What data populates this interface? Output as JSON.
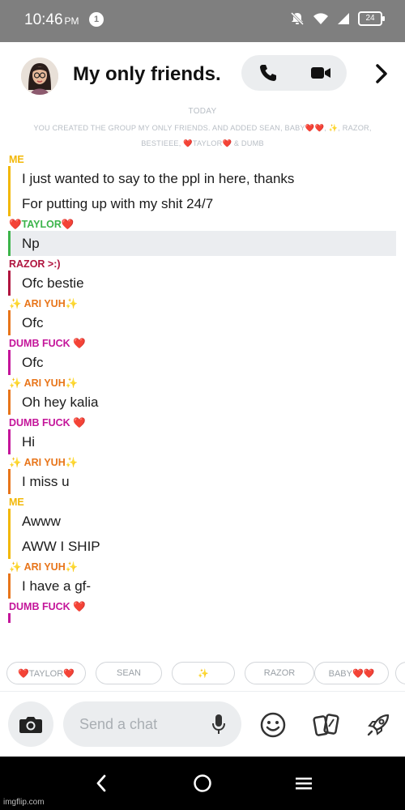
{
  "status_bar": {
    "time": "10:46",
    "ampm": "PM",
    "notification_count": "1",
    "battery": "24"
  },
  "header": {
    "title": "My only friends.",
    "call_icon": "phone-icon",
    "video_icon": "video-camera-icon",
    "more_icon": "chevron-right-icon"
  },
  "chat": {
    "date_label": "TODAY",
    "system_message": "YOU CREATED THE GROUP MY ONLY FRIENDS. AND ADDED SEAN, BABY❤️❤️, ✨, RAZOR, BESTIEEE, ❤️TAYLOR❤️ & DUMB",
    "groups": [
      {
        "sender": "ME",
        "color": "#f2b705",
        "messages": [
          "I just wanted to say to the ppl in here, thanks",
          "For putting up with my shit 24/7"
        ]
      },
      {
        "sender": "❤️TAYLOR❤️",
        "color": "#3cb44b",
        "messages": [
          "Np"
        ],
        "highlight": true
      },
      {
        "sender": "RAZOR >:)",
        "color": "#b0153f",
        "messages": [
          "Ofc bestie"
        ]
      },
      {
        "sender": "✨ ARI YUH✨",
        "color": "#e8751a",
        "messages": [
          "Ofc"
        ]
      },
      {
        "sender": "DUMB FUCK ❤️",
        "color": "#c4159a",
        "messages": [
          "Ofc"
        ]
      },
      {
        "sender": "✨ ARI YUH✨",
        "color": "#e8751a",
        "messages": [
          "Oh hey kalia"
        ]
      },
      {
        "sender": "DUMB FUCK ❤️",
        "color": "#c4159a",
        "messages": [
          "Hi"
        ]
      },
      {
        "sender": "✨ ARI YUH✨",
        "color": "#e8751a",
        "messages": [
          "I miss u"
        ]
      },
      {
        "sender": "ME",
        "color": "#f2b705",
        "messages": [
          "Awww",
          "AWW I SHIP"
        ]
      },
      {
        "sender": "✨ ARI YUH✨",
        "color": "#e8751a",
        "messages": [
          "I have a gf-"
        ]
      },
      {
        "sender": "DUMB FUCK ❤️",
        "color": "#c4159a",
        "messages": [
          ""
        ],
        "cut": true
      }
    ]
  },
  "chips": [
    "❤️TAYLOR❤️",
    "SEAN",
    "✨",
    "RAZOR",
    "BABY❤️❤️"
  ],
  "composer": {
    "placeholder": "Send a chat"
  },
  "colors": {
    "me": "#f2b705",
    "taylor": "#3cb44b",
    "razor": "#b0153f",
    "ari": "#e8751a",
    "dumb": "#c4159a",
    "status_bar": "#7f7f7f"
  },
  "watermark": "imgflip.com"
}
